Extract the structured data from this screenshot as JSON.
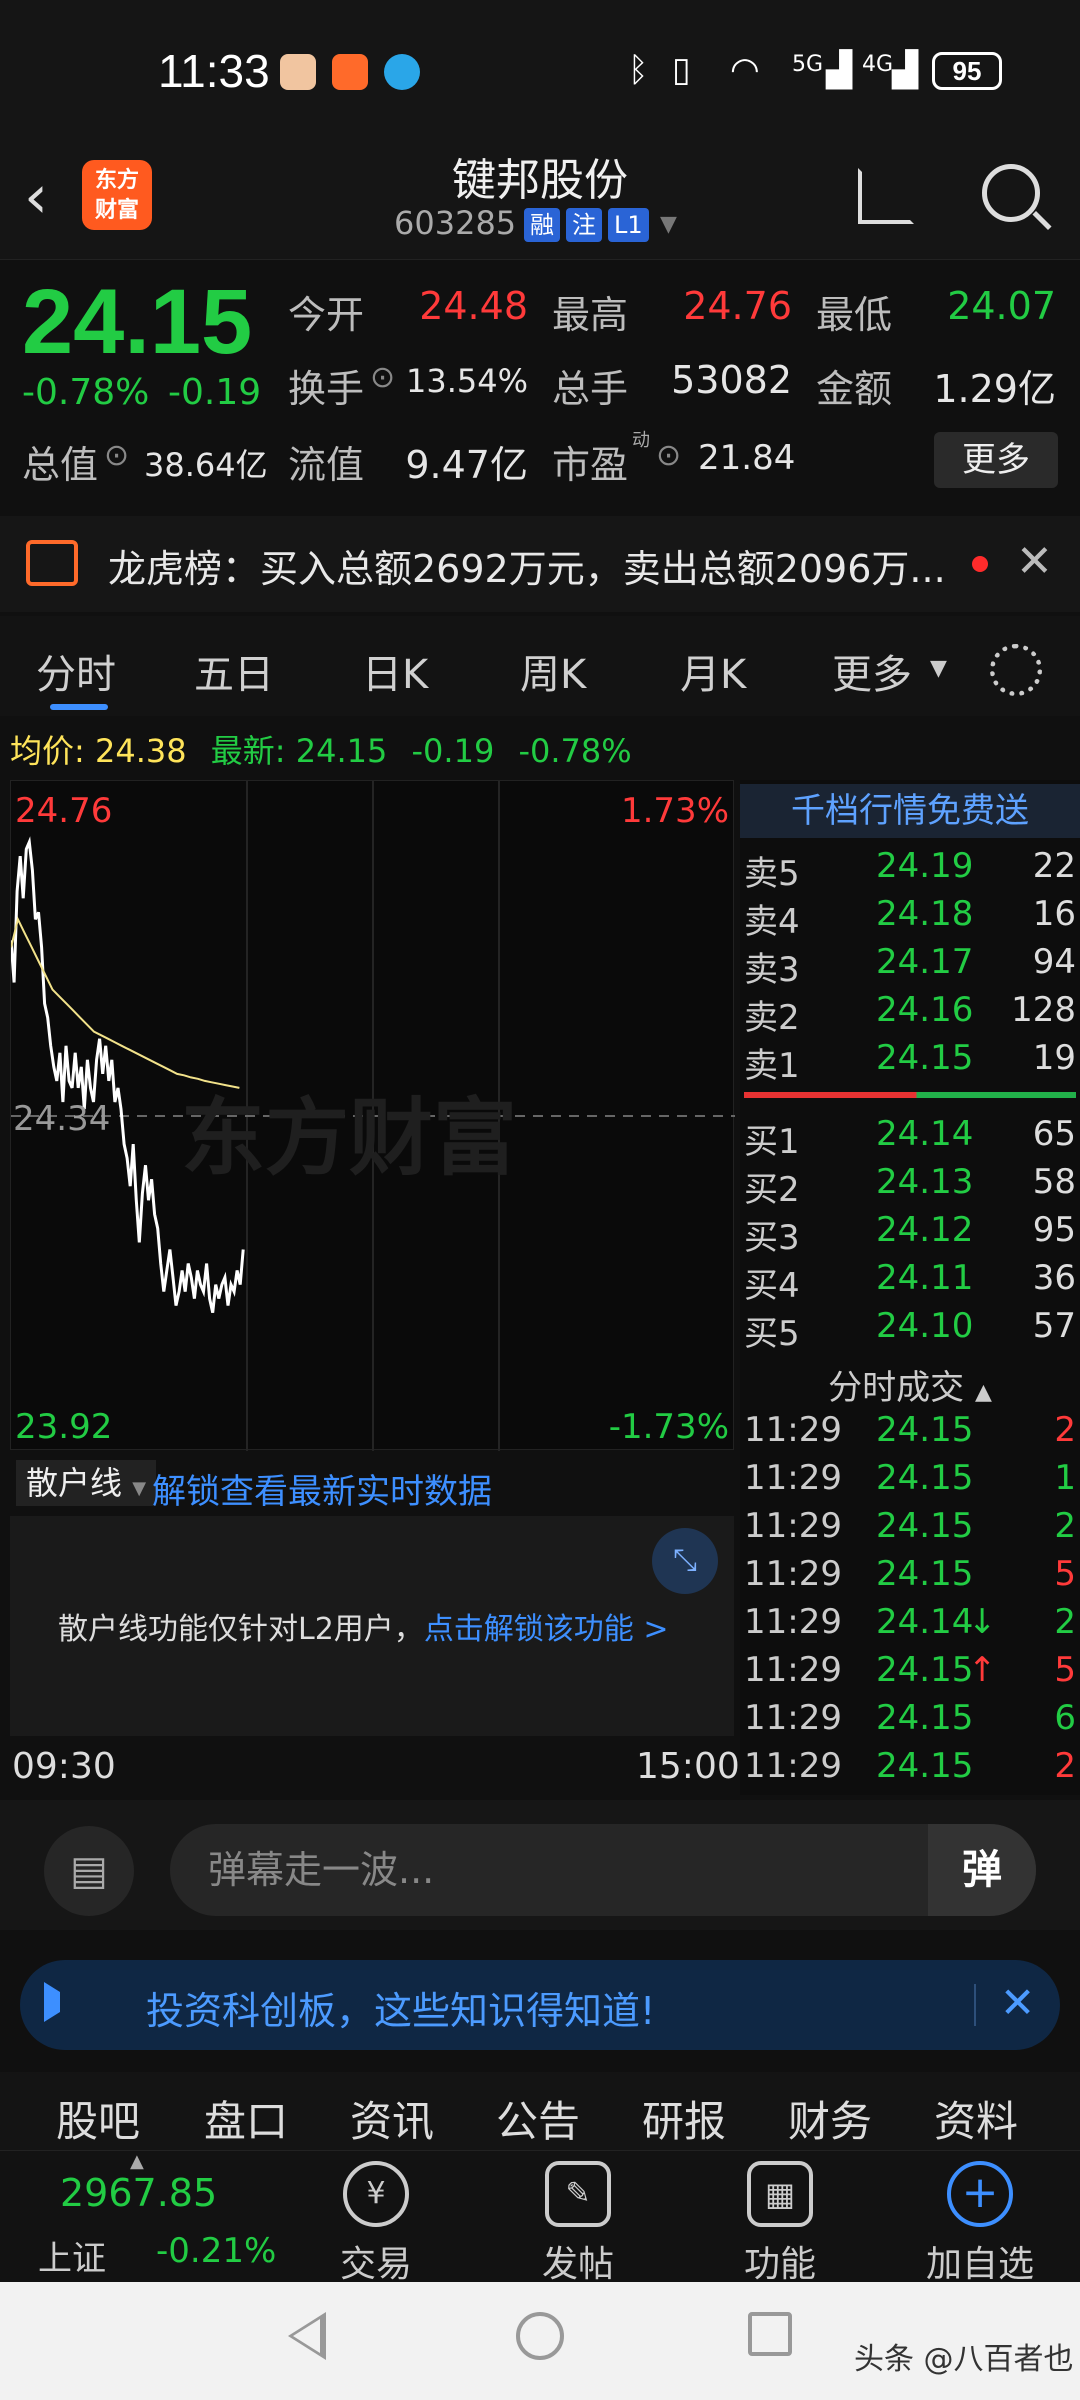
{
  "status_bar": {
    "time": "11:33",
    "battery": "95",
    "net_5g": "5G",
    "net_4g": "4G"
  },
  "header": {
    "stock_name": "键邦股份",
    "stock_code": "603285",
    "tags": [
      "融",
      "注",
      "L1"
    ]
  },
  "quote": {
    "price": "24.15",
    "change_pct": "-0.78%",
    "change_amt": "-0.19",
    "open_label": "今开",
    "open": "24.48",
    "high_label": "最高",
    "high": "24.76",
    "low_label": "最低",
    "low": "24.07",
    "turnover_label": "换手",
    "turnover": "13.54%",
    "volume_label": "总手",
    "volume": "53082",
    "amount_label": "金额",
    "amount": "1.29亿",
    "mktcap_label": "总值",
    "mktcap": "38.64亿",
    "float_label": "流值",
    "float_cap": "9.47亿",
    "pe_label": "市盈",
    "pe_sup": "动",
    "pe": "21.84",
    "more": "更多"
  },
  "billboard": {
    "text": "龙虎榜：买入总额2692万元，卖出总额2096万..."
  },
  "tabs": [
    "分时",
    "五日",
    "日K",
    "周K",
    "月K",
    "更多"
  ],
  "avg_line": {
    "avg_label": "均价:",
    "avg": "24.38",
    "latest_label": "最新:",
    "latest": "24.15",
    "chg": "-0.19",
    "pct": "-0.78%"
  },
  "chart": {
    "high": "24.76",
    "high_pct": "1.73%",
    "low": "23.92",
    "low_pct": "-1.73%",
    "mid": "24.34",
    "watermark": "东方财富",
    "time_start": "09:30",
    "time_end": "15:00"
  },
  "chart_data": {
    "type": "line",
    "ylim": [
      23.92,
      24.76
    ],
    "reference": 24.34,
    "series": [
      {
        "values": [
          24.59,
          24.53,
          24.66,
          24.71,
          24.65,
          24.72,
          24.73,
          24.69,
          24.62,
          24.63,
          24.58,
          24.5,
          24.48,
          24.44,
          24.41,
          24.39,
          24.43,
          24.36,
          24.44,
          24.39,
          24.38,
          24.43,
          24.38,
          24.41,
          24.35,
          24.42,
          24.38,
          24.36,
          24.42,
          24.45,
          24.4,
          24.44,
          24.39,
          24.42,
          24.36,
          24.38,
          24.35,
          24.3,
          24.28,
          24.24,
          24.3,
          24.22,
          24.16,
          24.23,
          24.27,
          24.22,
          24.25,
          24.2,
          24.18,
          24.13,
          24.09,
          24.12,
          24.15,
          24.11,
          24.07,
          24.09,
          24.12,
          24.09,
          24.13,
          24.11,
          24.08,
          24.12,
          24.1,
          24.09,
          24.13,
          24.08,
          24.06,
          24.1,
          24.08,
          24.1,
          24.11,
          24.07,
          24.1,
          24.09,
          24.12,
          24.1,
          24.15
        ]
      },
      {
        "values": [
          24.58,
          24.62,
          24.6,
          24.58,
          24.56,
          24.54,
          24.52,
          24.51,
          24.5,
          24.49,
          24.48,
          24.47,
          24.46,
          24.455,
          24.45,
          24.445,
          24.44,
          24.435,
          24.43,
          24.425,
          24.42,
          24.415,
          24.41,
          24.405,
          24.4,
          24.398,
          24.395,
          24.393,
          24.39,
          24.388,
          24.386,
          24.384,
          24.382,
          24.38
        ]
      }
    ]
  },
  "order_book": {
    "title": "千档行情免费送",
    "asks": [
      {
        "label": "卖5",
        "price": "24.19",
        "vol": "22"
      },
      {
        "label": "卖4",
        "price": "24.18",
        "vol": "16"
      },
      {
        "label": "卖3",
        "price": "24.17",
        "vol": "94"
      },
      {
        "label": "卖2",
        "price": "24.16",
        "vol": "128"
      },
      {
        "label": "卖1",
        "price": "24.15",
        "vol": "19"
      }
    ],
    "bids": [
      {
        "label": "买1",
        "price": "24.14",
        "vol": "65"
      },
      {
        "label": "买2",
        "price": "24.13",
        "vol": "58"
      },
      {
        "label": "买3",
        "price": "24.12",
        "vol": "95"
      },
      {
        "label": "买4",
        "price": "24.11",
        "vol": "36"
      },
      {
        "label": "买5",
        "price": "24.10",
        "vol": "57"
      }
    ],
    "ticks_title": "分时成交",
    "ticks": [
      {
        "time": "11:29",
        "price": "24.15",
        "arrow": "",
        "vol": "2",
        "dir": "buy"
      },
      {
        "time": "11:29",
        "price": "24.15",
        "arrow": "",
        "vol": "1",
        "dir": "sell"
      },
      {
        "time": "11:29",
        "price": "24.15",
        "arrow": "",
        "vol": "2",
        "dir": "sell"
      },
      {
        "time": "11:29",
        "price": "24.15",
        "arrow": "",
        "vol": "5",
        "dir": "buy"
      },
      {
        "time": "11:29",
        "price": "24.14",
        "arrow": "↓",
        "vol": "2",
        "dir": "sell"
      },
      {
        "time": "11:29",
        "price": "24.15",
        "arrow": "↑",
        "vol": "5",
        "dir": "buy"
      },
      {
        "time": "11:29",
        "price": "24.15",
        "arrow": "",
        "vol": "6",
        "dir": "sell"
      },
      {
        "time": "11:29",
        "price": "24.15",
        "arrow": "",
        "vol": "2",
        "dir": "buy"
      }
    ]
  },
  "retail": {
    "tab": "散户线",
    "link": "解锁查看最新实时数据",
    "msg_a": "散户线功能仅针对L2用户，",
    "msg_b": "点击解锁该功能 >"
  },
  "danmaku": {
    "placeholder": "弹幕走一波...",
    "send": "弹"
  },
  "banner": {
    "text": "投资科创板，这些知识得知道!"
  },
  "bottom_tabs": [
    "股吧",
    "盘口",
    "资讯",
    "公告",
    "研报",
    "财务",
    "资料"
  ],
  "bottom_nav": {
    "index_value": "2967.85",
    "index_name": "上证",
    "index_change": "-0.21%",
    "items": [
      "交易",
      "发帖",
      "功能",
      "加自选"
    ]
  },
  "watermark_src": "头条 @八百者也",
  "colors": {
    "up": "#ff3a3a",
    "down": "#22cc44",
    "accent": "#3d8fff"
  }
}
